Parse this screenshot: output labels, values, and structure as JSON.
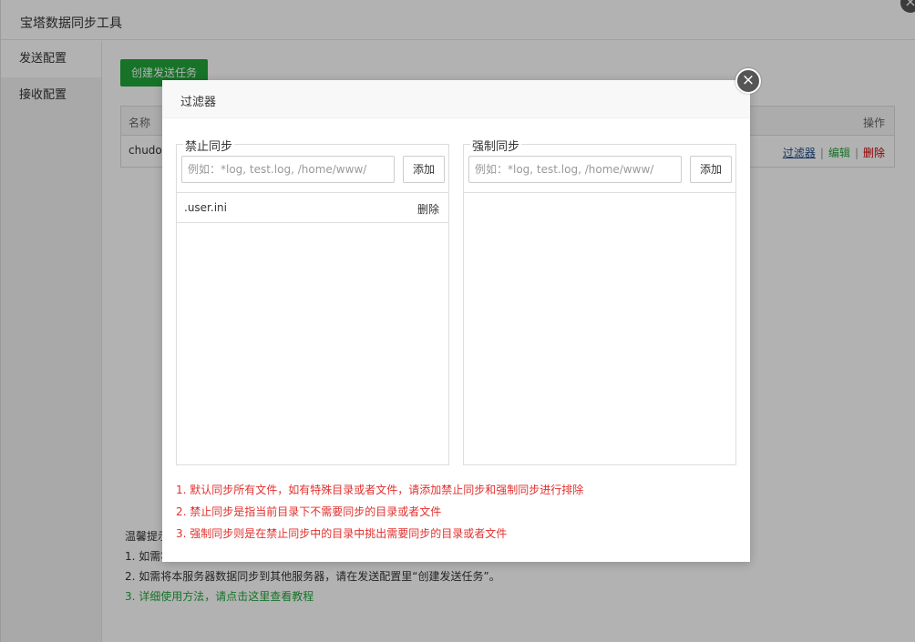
{
  "app": {
    "title": "宝塔数据同步工具",
    "close_glyph": "×"
  },
  "sidebar": {
    "items": [
      {
        "label": "发送配置",
        "active": true
      },
      {
        "label": "接收配置",
        "active": false
      }
    ]
  },
  "main": {
    "create_button": "创建发送任务",
    "table": {
      "headers": {
        "name": "名称",
        "operations": "操作"
      },
      "rows": [
        {
          "name": "chudor",
          "filter": "过滤器",
          "edit": "编辑",
          "delete": "删除",
          "separator": "|"
        }
      ]
    },
    "tips": {
      "title": "温馨提示",
      "lines": [
        "1. 如需将",
        "2. 如需将本服务器数据同步到其他服务器，请在发送配置里“创建发送任务”。",
        "3. 详细使用方法，请点击这里查看教程"
      ]
    }
  },
  "modal": {
    "title": "过滤器",
    "close_glyph": "×",
    "exclude": {
      "legend": "禁止同步",
      "placeholder": "例如：*log, test.log, /home/www/",
      "add_label": "添加",
      "items": [
        {
          "name": ".user.ini",
          "delete_label": "删除"
        }
      ]
    },
    "include": {
      "legend": "强制同步",
      "placeholder": "例如：*log, test.log, /home/www/",
      "add_label": "添加",
      "items": []
    },
    "notes": [
      "1. 默认同步所有文件，如有特殊目录或者文件，请添加禁止同步和强制同步进行排除",
      "2. 禁止同步是指当前目录下不需要同步的目录或者文件",
      "3. 强制同步则是在禁止同步中的目录中挑出需要同步的目录或者文件"
    ]
  },
  "colors": {
    "accent_green": "#20a53a",
    "note_red": "#e0302e",
    "link_blue": "#1f4e8a",
    "delete_red": "#cc0000"
  }
}
